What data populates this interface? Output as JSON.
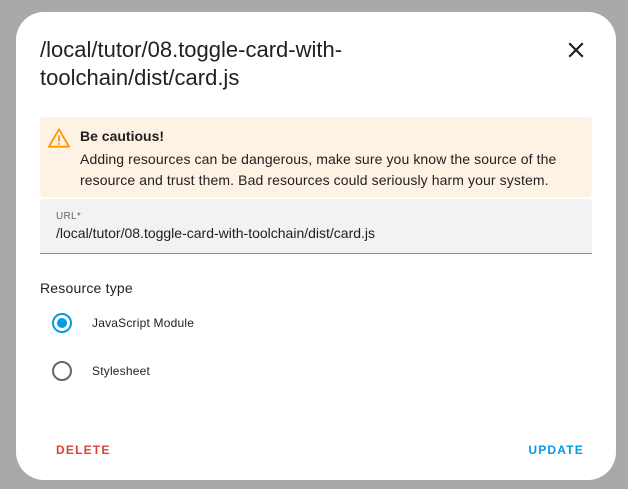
{
  "dialog": {
    "title": "/local/tutor/08.toggle-card-with-toolchain/dist/card.js"
  },
  "alert": {
    "icon": "warning-icon",
    "title": "Be cautious!",
    "message": "Adding resources can be dangerous, make sure you know the source of the resource and trust them. Bad resources could seriously harm your system."
  },
  "url_field": {
    "label": "URL*",
    "value": "/local/tutor/08.toggle-card-with-toolchain/dist/card.js"
  },
  "resource_type": {
    "label": "Resource type",
    "options": [
      {
        "label": "JavaScript Module",
        "selected": true
      },
      {
        "label": "Stylesheet",
        "selected": false
      }
    ]
  },
  "actions": {
    "delete_label": "DELETE",
    "update_label": "UPDATE"
  },
  "colors": {
    "accent": "#039be5",
    "danger": "#db4437",
    "warning_bg": "#fef2e5",
    "warning_icon": "#ff9800"
  }
}
